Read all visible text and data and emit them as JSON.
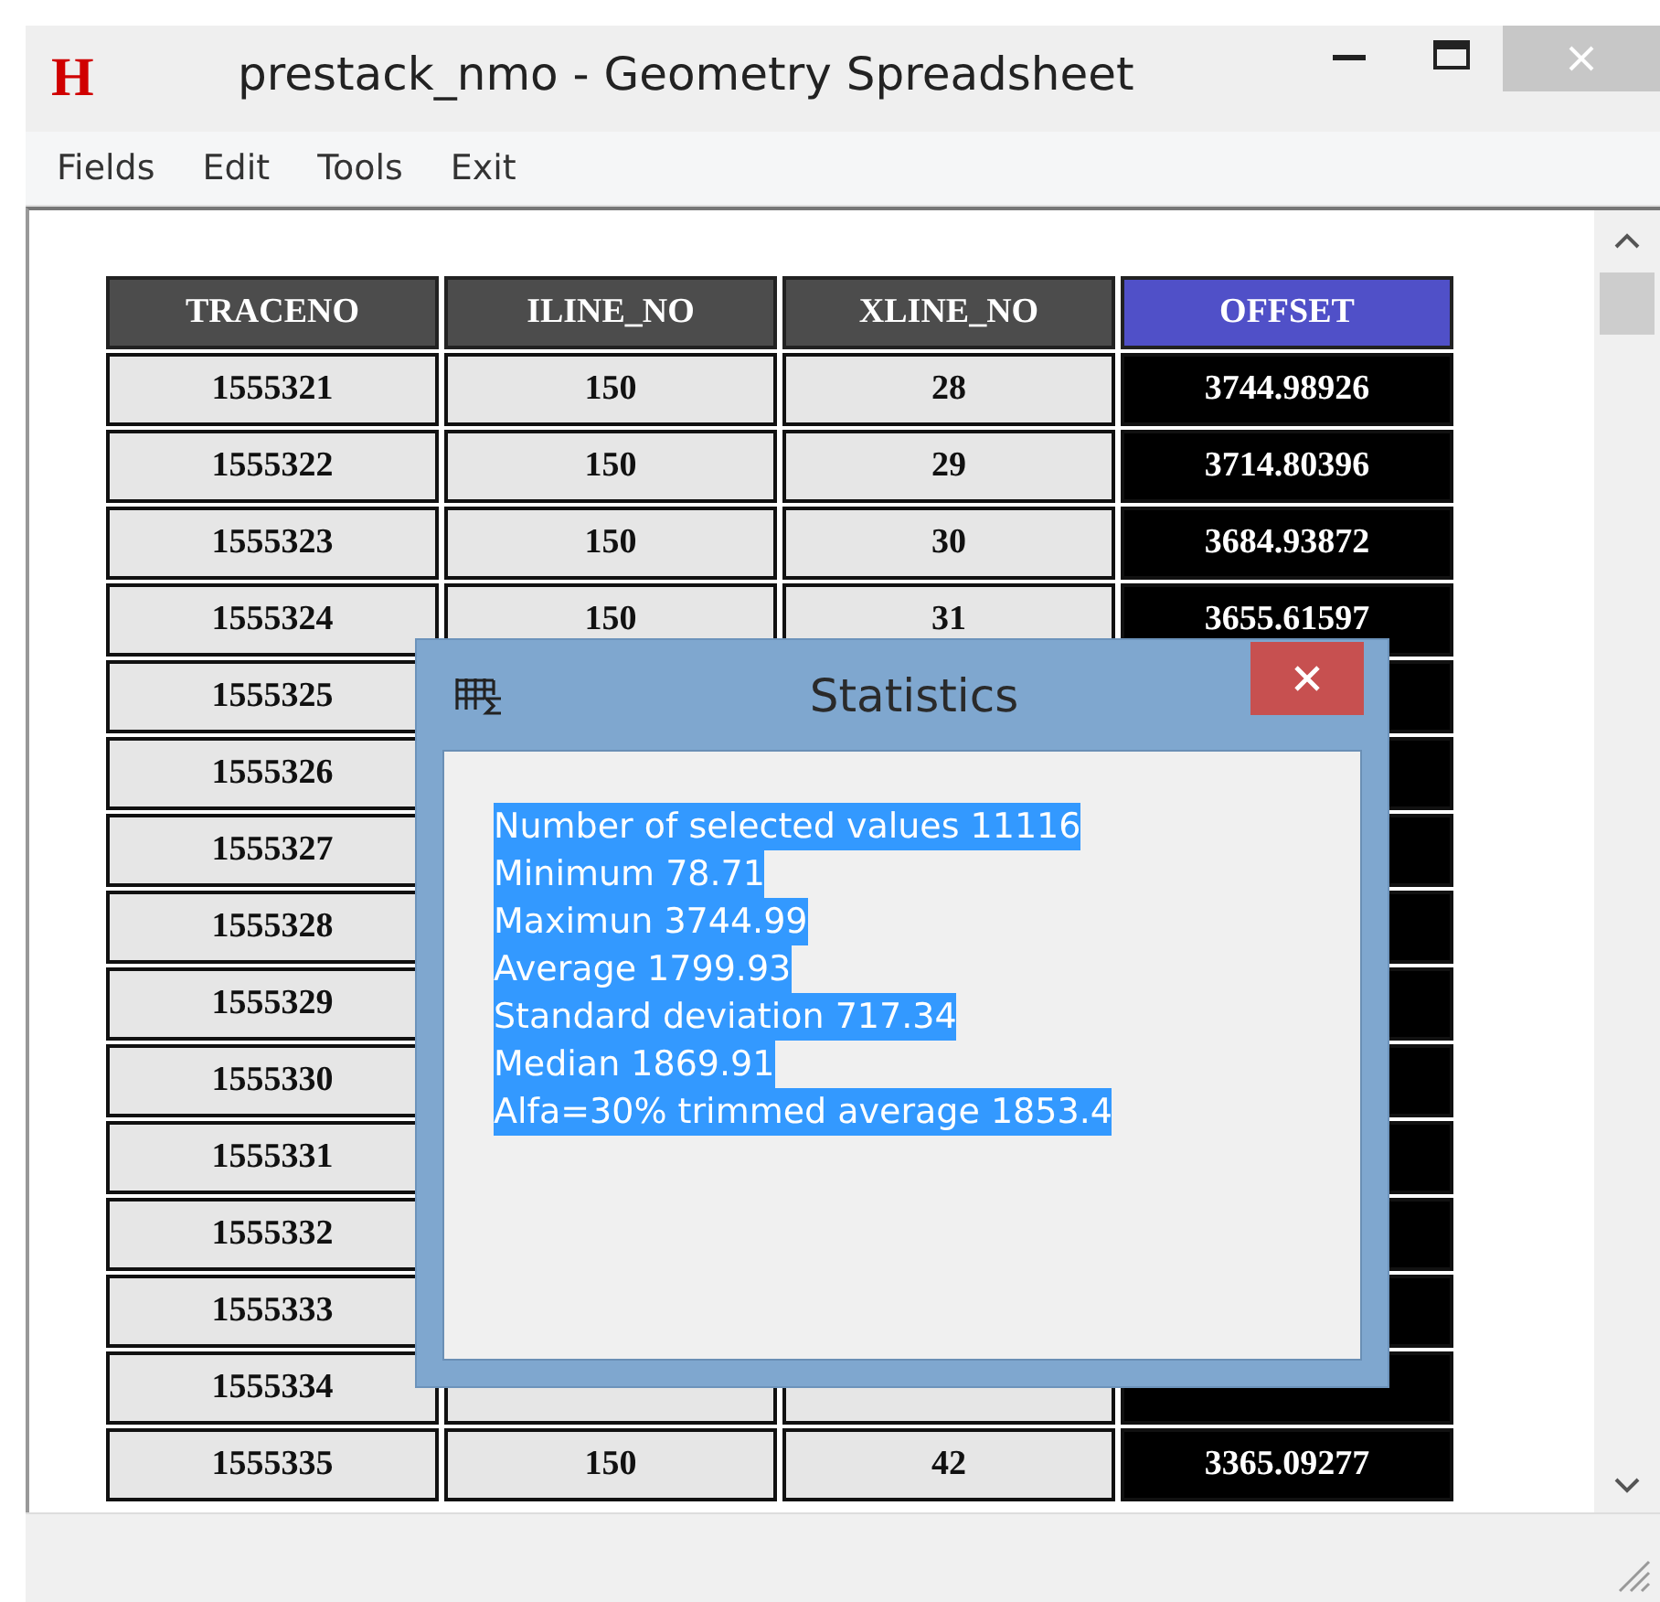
{
  "window": {
    "title": "prestack_nmo - Geometry Spreadsheet",
    "app_icon": "H"
  },
  "menu": [
    "Fields",
    "Edit",
    "Tools",
    "Exit"
  ],
  "table": {
    "columns": [
      {
        "label": "TRACENO",
        "selected": false
      },
      {
        "label": "ILINE_NO",
        "selected": false
      },
      {
        "label": "XLINE_NO",
        "selected": false
      },
      {
        "label": "OFFSET",
        "selected": true
      }
    ],
    "rows": [
      {
        "cells": [
          "1555321",
          "150",
          "28",
          "3744.98926"
        ]
      },
      {
        "cells": [
          "1555322",
          "150",
          "29",
          "3714.80396"
        ]
      },
      {
        "cells": [
          "1555323",
          "150",
          "30",
          "3684.93872"
        ]
      },
      {
        "cells": [
          "1555324",
          "150",
          "31",
          "3655.61597"
        ]
      },
      {
        "cells": [
          "1555325"
        ]
      },
      {
        "cells": [
          "1555326"
        ]
      },
      {
        "cells": [
          "1555327"
        ]
      },
      {
        "cells": [
          "1555328"
        ]
      },
      {
        "cells": [
          "1555329"
        ]
      },
      {
        "cells": [
          "1555330"
        ]
      },
      {
        "cells": [
          "1555331"
        ]
      },
      {
        "cells": [
          "1555332"
        ]
      },
      {
        "cells": [
          "1555333"
        ]
      },
      {
        "cells": [
          "1555334"
        ]
      },
      {
        "cells": [
          "1555335",
          "150",
          "42",
          "3365.09277"
        ]
      }
    ]
  },
  "dialog": {
    "title": "Statistics",
    "selected": true,
    "lines": [
      "Number of selected values 11116",
      "Minimum 78.71",
      "Maximun 3744.99",
      "Average 1799.93",
      "Standard deviation 717.34",
      "Median 1869.91",
      "Alfa=30% trimmed average 1853.4"
    ]
  }
}
